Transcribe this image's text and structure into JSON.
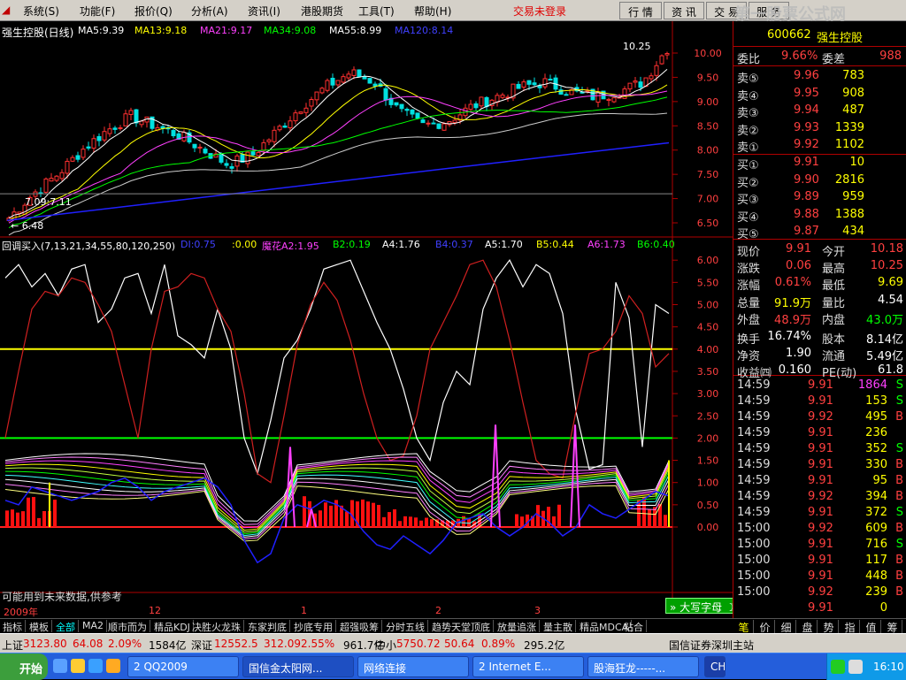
{
  "menubar": {
    "items": [
      "系统(S)",
      "功能(F)",
      "报价(Q)",
      "分析(A)",
      "资讯(I)",
      "港股期货",
      "工具(T)",
      "帮助(H)"
    ],
    "warning": "交易未登录",
    "right_tabs": [
      "行 情",
      "资 讯",
      "交 易",
      "服 务"
    ],
    "watermark": "第一股票公式网"
  },
  "main_chart": {
    "title": "强生控股(日线)",
    "ma_labels": [
      {
        "text": "MA5:9.39",
        "color": "#ffffff"
      },
      {
        "text": "MA13:9.18",
        "color": "#ffff00"
      },
      {
        "text": "MA21:9.17",
        "color": "#ff40ff"
      },
      {
        "text": "MA34:9.08",
        "color": "#00ff00"
      },
      {
        "text": "MA55:8.99",
        "color": "#ffffff"
      },
      {
        "text": "MA120:8.14",
        "color": "#4040ff"
      }
    ],
    "price_ticks": [
      "10.00",
      "9.50",
      "9.00",
      "8.50",
      "8.00",
      "7.50",
      "7.00",
      "6.50"
    ],
    "high_label": "10.25",
    "low_label": "6.48",
    "left_label": "7.09:7.11"
  },
  "indicator": {
    "title": "回调买入(7,13,21,34,55,80,120,250)",
    "labels": [
      {
        "text": "DI:0.75",
        "color": "#4040ff"
      },
      {
        "text": ":0.00",
        "color": "#ffff00"
      },
      {
        "text": "魔花A2:1.95",
        "color": "#ff40ff"
      },
      {
        "text": "B2:0.19",
        "color": "#00ff00"
      },
      {
        "text": "A4:1.76",
        "color": "#ffffff"
      },
      {
        "text": "B4:0.37",
        "color": "#4040ff"
      },
      {
        "text": "A5:1.70",
        "color": "#ffffff"
      },
      {
        "text": "B5:0.44",
        "color": "#ffff00"
      },
      {
        "text": "A6:1.73",
        "color": "#ff40ff"
      },
      {
        "text": "B6:0.40",
        "color": "#00ff00"
      }
    ],
    "ticks": [
      "6.00",
      "5.50",
      "5.00",
      "4.50",
      "4.00",
      "3.50",
      "3.00",
      "2.50",
      "2.00",
      "1.50",
      "1.00",
      "0.50",
      "0.00"
    ],
    "note": "可能用到未来数据,供参考"
  },
  "date_axis": [
    "2009年",
    "12",
    "1",
    "2",
    "3"
  ],
  "bottom_tabs": [
    "指标",
    "模板",
    "全部",
    "MA2",
    "顺市而为",
    "精品KDJ",
    "决胜火龙珠",
    "东家判底",
    "抄底专用",
    "超强吸筹",
    "分时五线",
    "趋势天堂顶底",
    "放量追涨",
    "量主散",
    "精品MDCA",
    "粘合"
  ],
  "ime": "大写字母",
  "quote": {
    "code": "600662",
    "name": "强生控股",
    "webi_label": "委比",
    "webi": "9.66%",
    "weicha_label": "委差",
    "weicha": "988",
    "asks": [
      {
        "label": "卖⑤",
        "price": "9.96",
        "vol": "783"
      },
      {
        "label": "卖④",
        "price": "9.95",
        "vol": "908"
      },
      {
        "label": "卖③",
        "price": "9.94",
        "vol": "487"
      },
      {
        "label": "卖②",
        "price": "9.93",
        "vol": "1339"
      },
      {
        "label": "卖①",
        "price": "9.92",
        "vol": "1102"
      }
    ],
    "bids": [
      {
        "label": "买①",
        "price": "9.91",
        "vol": "10"
      },
      {
        "label": "买②",
        "price": "9.90",
        "vol": "2816"
      },
      {
        "label": "买③",
        "price": "9.89",
        "vol": "959"
      },
      {
        "label": "买④",
        "price": "9.88",
        "vol": "1388"
      },
      {
        "label": "买⑤",
        "price": "9.87",
        "vol": "434"
      }
    ],
    "stats": [
      {
        "l1": "现价",
        "v1": "9.91",
        "c1": "#ff4040",
        "l2": "今开",
        "v2": "10.18",
        "c2": "#ff4040"
      },
      {
        "l1": "涨跌",
        "v1": "0.06",
        "c1": "#ff4040",
        "l2": "最高",
        "v2": "10.25",
        "c2": "#ff4040"
      },
      {
        "l1": "涨幅",
        "v1": "0.61%",
        "c1": "#ff4040",
        "l2": "最低",
        "v2": "9.69",
        "c2": "#ffff00"
      },
      {
        "l1": "总量",
        "v1": "91.9万",
        "c1": "#ffff00",
        "l2": "量比",
        "v2": "4.54",
        "c2": "#ffffff"
      },
      {
        "l1": "外盘",
        "v1": "48.9万",
        "c1": "#ff4040",
        "l2": "内盘",
        "v2": "43.0万",
        "c2": "#00ff00"
      },
      {
        "l1": "换手",
        "v1": "16.74%",
        "c1": "#ffffff",
        "l2": "股本",
        "v2": "8.14亿",
        "c2": "#ffffff"
      },
      {
        "l1": "净资",
        "v1": "1.90",
        "c1": "#ffffff",
        "l2": "流通",
        "v2": "5.49亿",
        "c2": "#ffffff"
      },
      {
        "l1": "收益㈣",
        "v1": "0.160",
        "c1": "#ffffff",
        "l2": "PE(动)",
        "v2": "61.8",
        "c2": "#ffffff"
      }
    ],
    "ticks": [
      {
        "t": "14:59",
        "p": "9.91",
        "v": "1864",
        "s": "S"
      },
      {
        "t": "14:59",
        "p": "9.91",
        "v": "153",
        "s": "S"
      },
      {
        "t": "14:59",
        "p": "9.92",
        "v": "495",
        "s": "B"
      },
      {
        "t": "14:59",
        "p": "9.91",
        "v": "236",
        "s": ""
      },
      {
        "t": "14:59",
        "p": "9.91",
        "v": "352",
        "s": "S"
      },
      {
        "t": "14:59",
        "p": "9.91",
        "v": "330",
        "s": "B"
      },
      {
        "t": "14:59",
        "p": "9.91",
        "v": "95",
        "s": "B"
      },
      {
        "t": "14:59",
        "p": "9.92",
        "v": "394",
        "s": "B"
      },
      {
        "t": "14:59",
        "p": "9.91",
        "v": "372",
        "s": "S"
      },
      {
        "t": "15:00",
        "p": "9.92",
        "v": "609",
        "s": "B"
      },
      {
        "t": "15:00",
        "p": "9.91",
        "v": "716",
        "s": "S"
      },
      {
        "t": "15:00",
        "p": "9.91",
        "v": "117",
        "s": "B"
      },
      {
        "t": "15:00",
        "p": "9.91",
        "v": "448",
        "s": "B"
      },
      {
        "t": "15:00",
        "p": "9.92",
        "v": "239",
        "s": "B"
      },
      {
        "t": "",
        "p": "9.91",
        "v": "0",
        "s": ""
      }
    ],
    "tabs": [
      "笔",
      "价",
      "细",
      "盘",
      "势",
      "指",
      "值",
      "筹"
    ]
  },
  "statusbar": {
    "sh_label": "上证",
    "sh_val": "3123.80",
    "sh_chg": "64.08",
    "sh_pct": "2.09%",
    "sh_amt": "1584亿",
    "sz_label": "深证",
    "sz_val": "12552.5",
    "sz_chg": "312.09",
    "sz_pct": "2.55%",
    "sz_amt": "961.7亿",
    "zx_label": "中小",
    "zx_val": "5750.72",
    "zx_chg": "50.64",
    "zx_pct": "0.89%",
    "zx_amt": "295.2亿",
    "server": "国信证券深圳主站"
  },
  "taskbar": {
    "start": "开始",
    "buttons": [
      "2 QQ2009",
      "国信金太阳网...",
      "网络连接",
      "2 Internet E...",
      "股海狂龙-----..."
    ],
    "lang": "CH",
    "clock": "16:10"
  }
}
